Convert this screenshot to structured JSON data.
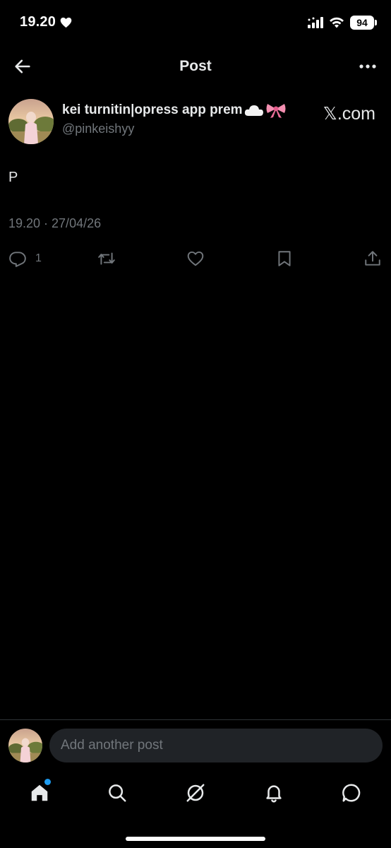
{
  "status_bar": {
    "time": "19.20",
    "battery": "94",
    "icons": [
      "heart-icon",
      "signal-icon",
      "wifi-icon",
      "battery-icon"
    ]
  },
  "header": {
    "title": "Post",
    "back_icon": "arrow-left-icon",
    "more_icon": "more-horizontal-icon"
  },
  "post": {
    "author": {
      "display_name": "kei turnitin|opress app prem",
      "emojis": [
        "cloud-emoji",
        "ribbon-emoji"
      ],
      "handle": "@pinkeishyy",
      "site_label": "𝕏.com"
    },
    "text": "P",
    "timestamp": "19.20 · 27/04/26",
    "actions": {
      "reply_count": "1",
      "icons": [
        "reply-icon",
        "repost-icon",
        "like-icon",
        "bookmark-icon",
        "share-icon"
      ]
    }
  },
  "reply_bar": {
    "placeholder": "Add another post"
  },
  "tab_bar": {
    "items": [
      "home-icon",
      "search-icon",
      "grok-icon",
      "notifications-icon",
      "messages-icon"
    ]
  },
  "colors": {
    "background": "#000000",
    "text_primary": "#e7e9ea",
    "text_secondary": "#71767b",
    "accent": "#1d9bf0",
    "input_bg": "#202327"
  }
}
